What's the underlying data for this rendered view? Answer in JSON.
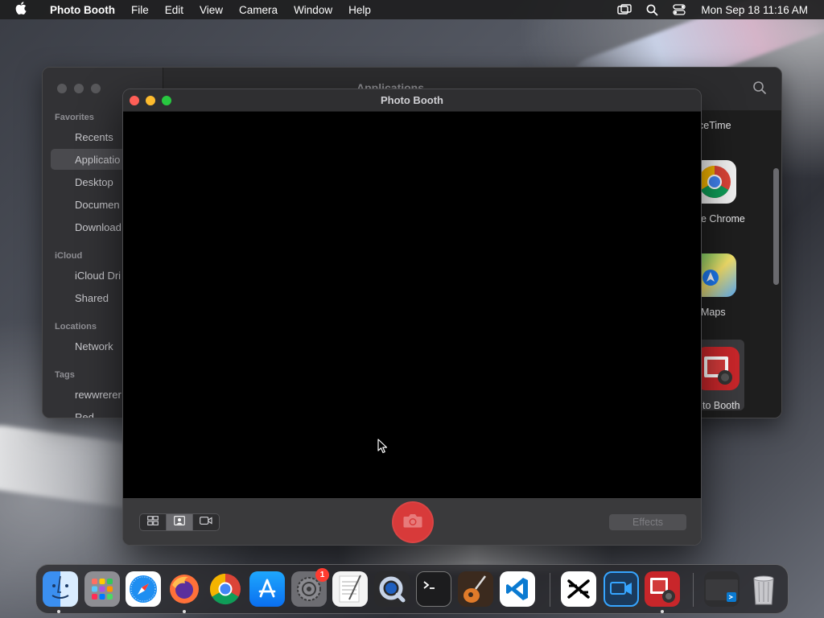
{
  "menubar": {
    "app_name": "Photo Booth",
    "menus": [
      "File",
      "Edit",
      "View",
      "Camera",
      "Window",
      "Help"
    ],
    "clock": "Mon Sep 18  11:16 AM"
  },
  "finder": {
    "title": "Applications",
    "sections": {
      "favorites": "Favorites",
      "icloud": "iCloud",
      "locations": "Locations",
      "tags": "Tags"
    },
    "sidebar_items": {
      "recents": "Recents",
      "applications": "Applicatio",
      "desktop": "Desktop",
      "documents": "Documen",
      "downloads": "Download",
      "icloud_drive": "iCloud Dri",
      "shared": "Shared",
      "network": "Network",
      "tag1": "rewwrerer",
      "tag2": "Red"
    },
    "apps": {
      "facetime": "ceTime",
      "chrome": "e Chrome",
      "maps": "Maps",
      "photobooth": "to Booth"
    }
  },
  "photobooth": {
    "title": "Photo Booth",
    "effects_label": "Effects"
  },
  "dock": {
    "settings_badge": "1"
  },
  "colors": {
    "close": "#ff5f57",
    "minimize": "#febc2e",
    "maximize": "#28c840",
    "shutter": "#d83a3a"
  }
}
